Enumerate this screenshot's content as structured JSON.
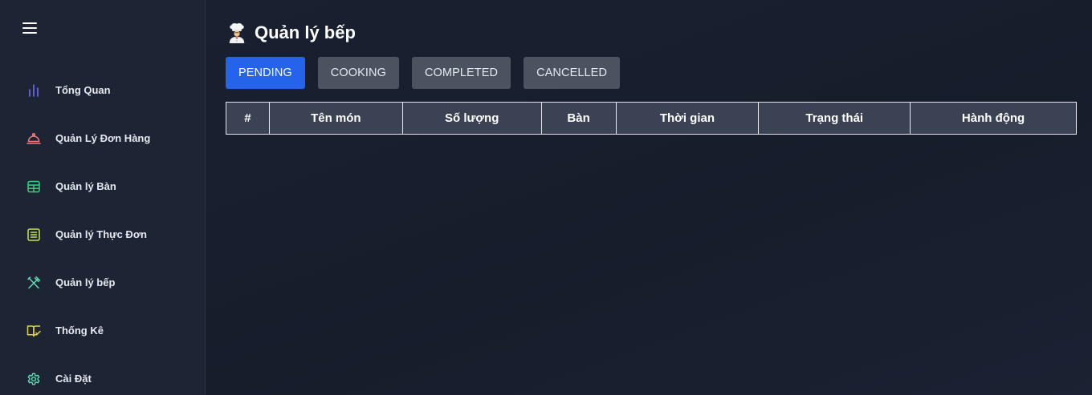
{
  "sidebar": {
    "items": [
      {
        "label": "Tổng Quan",
        "icon": "bar-chart-icon",
        "color": "#6d6dfa"
      },
      {
        "label": "Quản Lý Đơn Hàng",
        "icon": "cloche-icon",
        "color": "#f47c7c"
      },
      {
        "label": "Quản lý Bàn",
        "icon": "table-grid-icon",
        "color": "#34d37a"
      },
      {
        "label": "Quản lý Thực Đơn",
        "icon": "menu-list-icon",
        "color": "#c6e64a"
      },
      {
        "label": "Quản lý bếp",
        "icon": "utensils-icon",
        "color": "#5ee0b2"
      },
      {
        "label": "Thống Kê",
        "icon": "book-check-icon",
        "color": "#e4d23c"
      },
      {
        "label": "Cài Đặt",
        "icon": "gear-icon",
        "color": "#5ee0b2"
      }
    ]
  },
  "header": {
    "title": "Quản lý bếp",
    "icon": "chef-icon"
  },
  "tabs": [
    {
      "label": "PENDING",
      "active": true
    },
    {
      "label": "COOKING",
      "active": false
    },
    {
      "label": "COMPLETED",
      "active": false
    },
    {
      "label": "CANCELLED",
      "active": false
    }
  ],
  "table": {
    "columns": [
      "#",
      "Tên món",
      "Số lượng",
      "Bàn",
      "Thời gian",
      "Trạng thái",
      "Hành động"
    ],
    "rows": []
  },
  "colors": {
    "accent": "#2563eb",
    "tab_inactive": "#4b5260",
    "sidebar_bg": "#1d2433",
    "main_bg": "#161d2b"
  }
}
